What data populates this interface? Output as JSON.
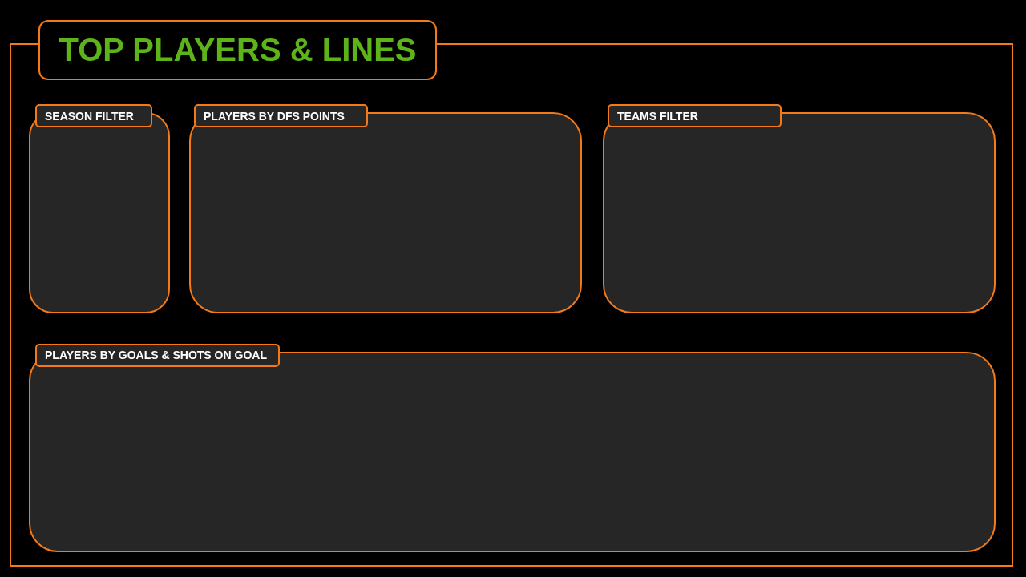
{
  "title": "TOP PLAYERS & LINES",
  "panel_rows": [
    {
      "panels": [
        {
          "label": "SEASON FILTER"
        },
        {
          "label": "PLAYERS BY DFS POINTS"
        },
        {
          "label": "TEAMS FILTER"
        }
      ]
    },
    {
      "panels": [
        {
          "label": "PLAYERS BY GOALS & SHOTS ON GOAL"
        }
      ]
    }
  ]
}
